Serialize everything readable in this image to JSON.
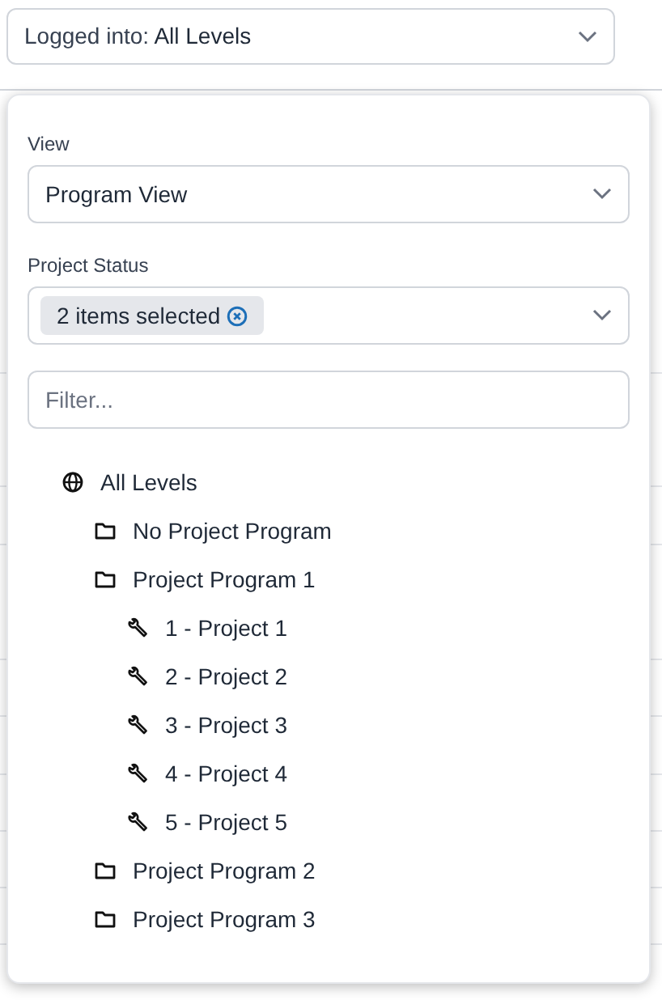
{
  "login_select": {
    "label": "Logged into:",
    "value": "All Levels"
  },
  "popup": {
    "view": {
      "label": "View",
      "value": "Program View"
    },
    "project_status": {
      "label": "Project Status",
      "chip": "2 items selected"
    },
    "filter": {
      "placeholder": "Filter..."
    },
    "tree": [
      {
        "kind": "level",
        "label": "All Levels",
        "children": [
          {
            "kind": "program",
            "label": "No Project Program"
          },
          {
            "kind": "program",
            "label": "Project Program 1",
            "children": [
              {
                "kind": "project",
                "label": "1 - Project 1"
              },
              {
                "kind": "project",
                "label": "2 - Project 2"
              },
              {
                "kind": "project",
                "label": "3 - Project 3"
              },
              {
                "kind": "project",
                "label": "4 - Project 4"
              },
              {
                "kind": "project",
                "label": "5 - Project 5"
              }
            ]
          },
          {
            "kind": "program",
            "label": "Project Program 2"
          },
          {
            "kind": "program",
            "label": "Project Program 3"
          }
        ]
      }
    ]
  }
}
